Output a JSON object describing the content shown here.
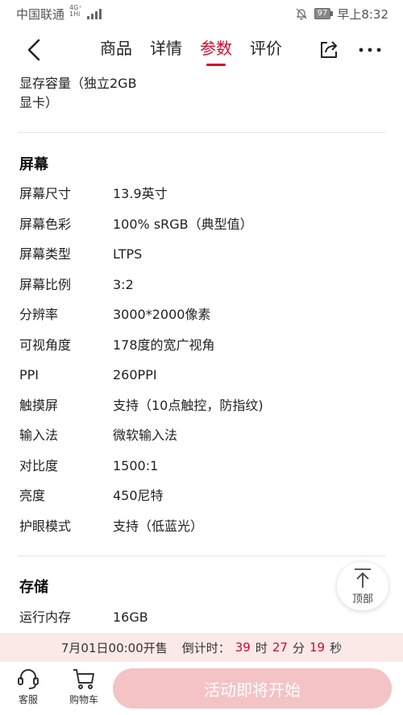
{
  "status_bar": {
    "carrier": "中国联通",
    "network_badge": "4G⁺",
    "network_sub": "1Hi",
    "battery": "97",
    "time": "早上8:32",
    "icons": [
      "signal-icon",
      "bell-off-icon",
      "battery-icon"
    ]
  },
  "nav": {
    "tabs": [
      {
        "label": "商品",
        "active": false
      },
      {
        "label": "详情",
        "active": false
      },
      {
        "label": "参数",
        "active": true
      },
      {
        "label": "评价",
        "active": false
      }
    ],
    "icons": [
      "back-icon",
      "share-icon",
      "more-icon"
    ],
    "accent_color": "#cf0a2c"
  },
  "prev_value": {
    "line1": "显存容量（独立2GB",
    "line2": "显卡）"
  },
  "sections": [
    {
      "title": "屏幕",
      "rows": [
        {
          "label": "屏幕尺寸",
          "value": "13.9英寸"
        },
        {
          "label": "屏幕色彩",
          "value": "100% sRGB（典型值）"
        },
        {
          "label": "屏幕类型",
          "value": "LTPS"
        },
        {
          "label": "屏幕比例",
          "value": "3:2"
        },
        {
          "label": "分辨率",
          "value": "3000*2000像素"
        },
        {
          "label": "可视角度",
          "value": "178度的宽广视角"
        },
        {
          "label": "PPI",
          "value": "260PPI"
        },
        {
          "label": "触摸屏",
          "value": "支持（10点触控，防指纹)"
        },
        {
          "label": "输入法",
          "value": "微软输入法"
        },
        {
          "label": "对比度",
          "value": "1500:1"
        },
        {
          "label": "亮度",
          "value": "450尼特"
        },
        {
          "label": "护眼模式",
          "value": "支持（低蓝光）"
        }
      ]
    },
    {
      "title": "存储",
      "rows": [
        {
          "label": "运行内存",
          "value": "16GB"
        }
      ]
    }
  ],
  "top_button": {
    "label": "顶部"
  },
  "countdown": {
    "sale_text": "7月01日00:00开售",
    "prefix": "倒计时：",
    "hours": "39",
    "hours_unit": "时",
    "minutes": "27",
    "minutes_unit": "分",
    "seconds": "19",
    "seconds_unit": "秒"
  },
  "bottom_bar": {
    "service_label": "客服",
    "cart_label": "购物车",
    "buy_label": "活动即将开始",
    "buy_color": "#f4c3c6"
  }
}
